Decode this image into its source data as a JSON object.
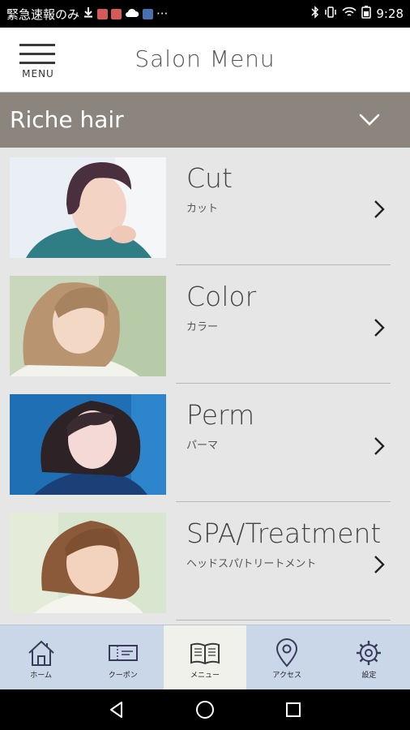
{
  "status_bar": {
    "notification_text": "緊急速報のみ",
    "time": "9:28",
    "more": "···",
    "icons": [
      "download-icon",
      "gmail-icon",
      "gmail-icon",
      "cloud-icon",
      "app-icon",
      "bluetooth-icon",
      "vibrate-icon",
      "wifi-icon",
      "battery-icon"
    ]
  },
  "header": {
    "menu_label": "MENU",
    "title": "Salon Menu"
  },
  "salon_selector": {
    "name": "Riche hair",
    "icon": "chevron-down-icon"
  },
  "menu_items": [
    {
      "title": "Cut",
      "subtitle": "カット"
    },
    {
      "title": "Color",
      "subtitle": "カラー"
    },
    {
      "title": "Perm",
      "subtitle": "パーマ"
    },
    {
      "title": "SPA/Treatment",
      "subtitle": "ヘッドスパ/トリートメント"
    }
  ],
  "tabs": [
    {
      "label": "ホーム",
      "icon": "home-icon",
      "active": false
    },
    {
      "label": "クーポン",
      "icon": "coupon-icon",
      "active": false
    },
    {
      "label": "メニュー",
      "icon": "book-icon",
      "active": true
    },
    {
      "label": "アクセス",
      "icon": "map-pin-icon",
      "active": false
    },
    {
      "label": "設定",
      "icon": "gear-icon",
      "active": false
    }
  ],
  "colors": {
    "salon_bar": "#8b857d",
    "tab_bar": "#c9d7e8",
    "tab_active": "#f1f1ec",
    "background": "#e6e6e6"
  }
}
